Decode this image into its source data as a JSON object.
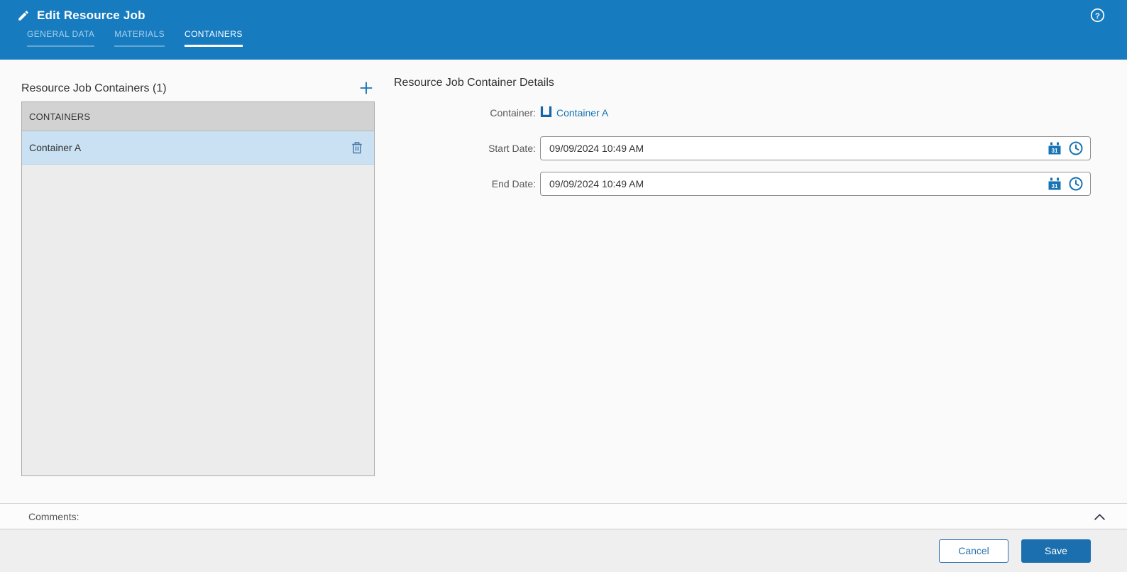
{
  "header": {
    "title": "Edit Resource Job",
    "tabs": [
      {
        "label": "GENERAL DATA",
        "active": false
      },
      {
        "label": "MATERIALS",
        "active": false
      },
      {
        "label": "CONTAINERS",
        "active": true
      }
    ],
    "icons": {
      "title": "pencil-icon",
      "help": "help-icon"
    }
  },
  "left_panel": {
    "title": "Resource Job Containers (1)",
    "add_icon": "plus-icon",
    "list_header": "CONTAINERS",
    "items": [
      {
        "name": "Container A",
        "selected": true,
        "delete_icon": "trash-icon"
      }
    ]
  },
  "details": {
    "title": "Resource Job Container Details",
    "container_label": "Container:",
    "container_value": "Container A",
    "container_icon": "container-icon",
    "start_date_label": "Start Date:",
    "start_date_value": "09/09/2024 10:49 AM",
    "end_date_label": "End Date:",
    "end_date_value": "09/09/2024 10:49 AM",
    "field_icons": {
      "calendar": "calendar-icon",
      "clock": "clock-icon",
      "calendar_day": "31"
    }
  },
  "comments": {
    "label": "Comments:",
    "collapse_icon": "chevron-up-icon"
  },
  "footer": {
    "cancel_label": "Cancel",
    "save_label": "Save"
  },
  "colors": {
    "header_blue": "#177bc0",
    "accent_blue": "#1673b4",
    "save_button": "#1b6fae",
    "selected_row": "#c9e1f2",
    "list_header_bg": "#d2d2d2",
    "panel_bg": "#ececec",
    "footer_bg": "#efefef"
  }
}
